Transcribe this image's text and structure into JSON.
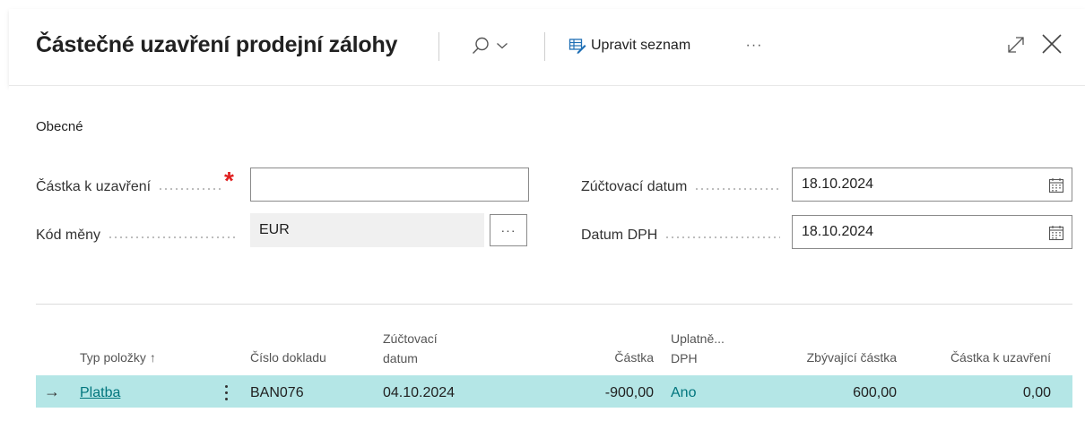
{
  "dialog": {
    "title": "Částečné uzavření prodejní zálohy",
    "edit_list_label": "Upravit seznam",
    "more_label": "···",
    "icons": {
      "search": "search-icon",
      "dropdown": "chevron-down-icon",
      "edit_list": "edit-list-icon",
      "expand": "expand-icon",
      "close": "close-icon"
    }
  },
  "general": {
    "group_title": "Obecné",
    "amount_label": "Částka k uzavření",
    "amount_value": "",
    "required_mark": "*",
    "currency_label": "Kód měny",
    "currency_value": "EUR",
    "assist_label": "···",
    "posting_date_label": "Zúčtovací datum",
    "posting_date_value": "18.10.2024",
    "vat_date_label": "Datum DPH",
    "vat_date_value": "18.10.2024"
  },
  "list": {
    "columns": {
      "entry_type": "Typ položky ↑",
      "document_no": "Číslo dokladu",
      "posting_date_line1": "Zúčtovací",
      "posting_date_line2": "datum",
      "amount": "Částka",
      "vat_applied_line1": "Uplatně...",
      "vat_applied_line2": "DPH",
      "remaining_amount": "Zbývající částka",
      "amount_to_close": "Částka k uzavření"
    },
    "rows": [
      {
        "arrow": "→",
        "entry_type": "Platba",
        "document_no": "BAN076",
        "posting_date": "04.10.2024",
        "amount": "-900,00",
        "vat_applied": "Ano",
        "remaining_amount": "600,00",
        "amount_to_close": "0,00"
      }
    ]
  },
  "colors": {
    "accent": "#00757d",
    "selected_row": "#b4e6e6",
    "required": "#e02020"
  }
}
